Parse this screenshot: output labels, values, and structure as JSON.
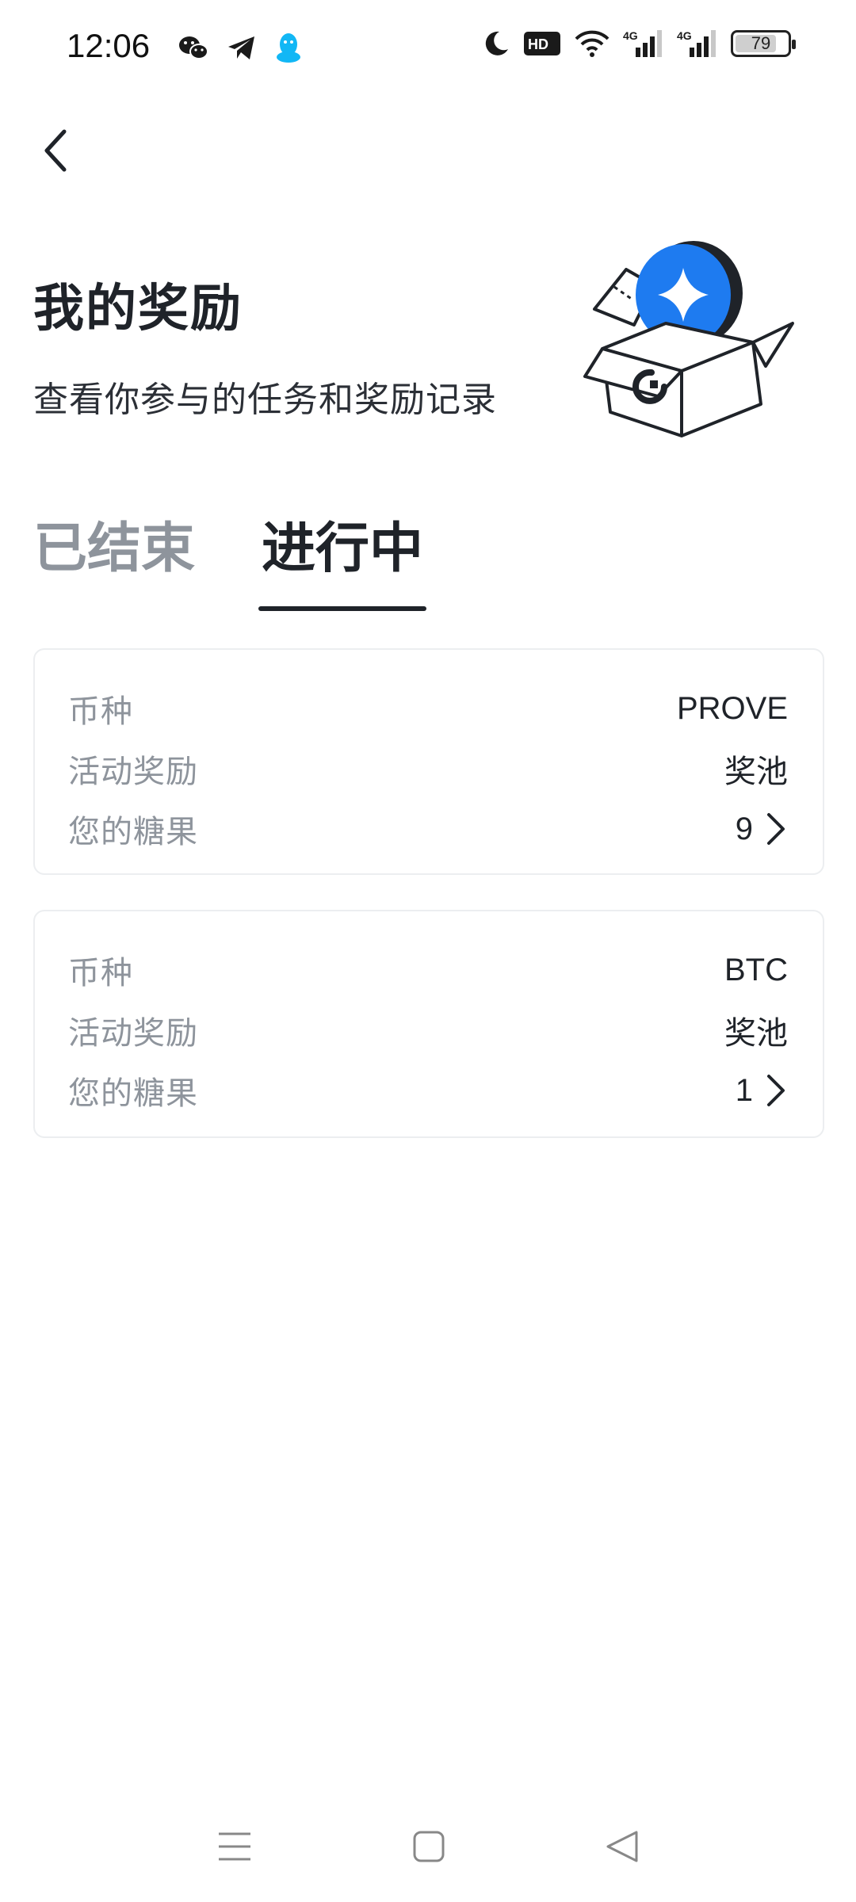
{
  "status_bar": {
    "time": "12:06",
    "app_icons": [
      "wechat-icon",
      "telegram-icon",
      "qq-icon"
    ],
    "indicators": [
      "moon-icon",
      "hd-icon",
      "wifi-icon",
      "signal-4g-icon",
      "signal-4g-icon"
    ],
    "hd_label": "HD",
    "network_1": "4G",
    "network_2": "4G",
    "battery": "79",
    "battery_level": 0.79
  },
  "header": {
    "title": "我的奖励",
    "subtitle": "查看你参与的任务和奖励记录"
  },
  "tabs": [
    {
      "label": "已结束",
      "active": false
    },
    {
      "label": "进行中",
      "active": true
    }
  ],
  "cards": [
    {
      "coin_label": "币种",
      "coin_value": "PROVE",
      "reward_label": "活动奖励",
      "reward_value": "奖池",
      "candy_label": "您的糖果",
      "candy_value": "9"
    },
    {
      "coin_label": "币种",
      "coin_value": "BTC",
      "reward_label": "活动奖励",
      "reward_value": "奖池",
      "candy_label": "您的糖果",
      "candy_value": "1"
    }
  ],
  "colors": {
    "accent_blue": "#1e7bf0",
    "text_primary": "#1f2329",
    "text_secondary": "#8e949c",
    "card_border": "#eceef0"
  }
}
